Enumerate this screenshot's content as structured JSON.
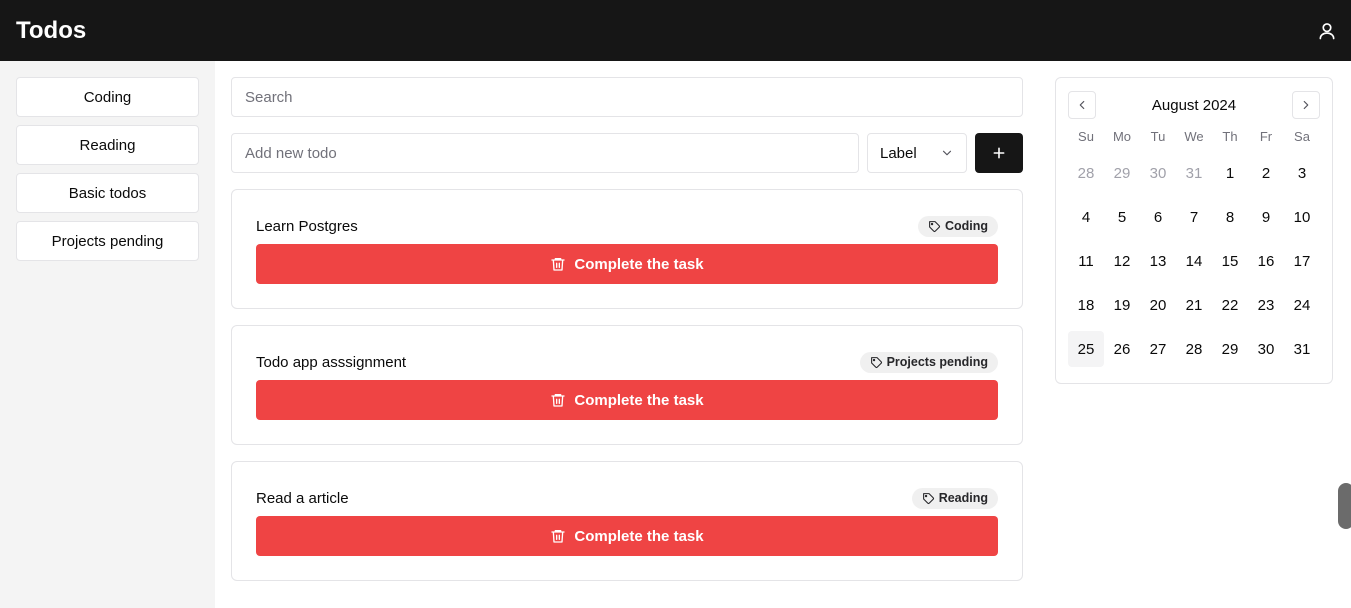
{
  "header": {
    "title": "Todos",
    "user_icon": "user-icon"
  },
  "sidebar": {
    "items": [
      {
        "label": "Coding"
      },
      {
        "label": "Reading"
      },
      {
        "label": "Basic todos"
      },
      {
        "label": "Projects pending"
      }
    ]
  },
  "search": {
    "placeholder": "Search",
    "value": ""
  },
  "add_todo": {
    "placeholder": "Add new todo",
    "value": "",
    "label_select": "Label",
    "add_icon": "plus-icon"
  },
  "todos": [
    {
      "text": "Learn Postgres",
      "tag": "Coding",
      "button": "Complete the task"
    },
    {
      "text": "Todo app asssignment",
      "tag": "Projects pending",
      "button": "Complete the task"
    },
    {
      "text": "Read a article",
      "tag": "Reading",
      "button": "Complete the task"
    }
  ],
  "calendar": {
    "month": "August 2024",
    "weekdays": [
      "Su",
      "Mo",
      "Tu",
      "We",
      "Th",
      "Fr",
      "Sa"
    ],
    "weeks": [
      [
        "28",
        "29",
        "30",
        "31",
        "1",
        "2",
        "3"
      ],
      [
        "4",
        "5",
        "6",
        "7",
        "8",
        "9",
        "10"
      ],
      [
        "11",
        "12",
        "13",
        "14",
        "15",
        "16",
        "17"
      ],
      [
        "18",
        "19",
        "20",
        "21",
        "22",
        "23",
        "24"
      ],
      [
        "25",
        "26",
        "27",
        "28",
        "29",
        "30",
        "31"
      ]
    ],
    "outside_days_first_week": 4,
    "today": "25"
  },
  "colors": {
    "header_bg": "#161616",
    "danger": "#ef4444",
    "sidebar_bg": "#f4f4f4"
  }
}
